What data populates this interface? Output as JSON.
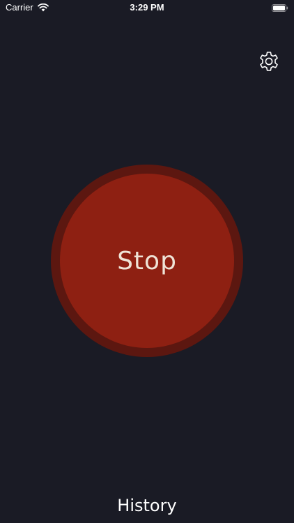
{
  "status_bar": {
    "carrier": "Carrier",
    "time": "3:29 PM",
    "wifi_icon": "wifi-icon",
    "battery_icon": "battery-icon"
  },
  "settings": {
    "icon": "gear-icon"
  },
  "stop_button": {
    "label": "Stop"
  },
  "footer": {
    "history_label": "History"
  },
  "colors": {
    "background": "#1a1b25",
    "button_ring": "#5c1710",
    "button_fill": "#8e2012",
    "button_text": "#efe3d6",
    "text": "#ffffff"
  }
}
